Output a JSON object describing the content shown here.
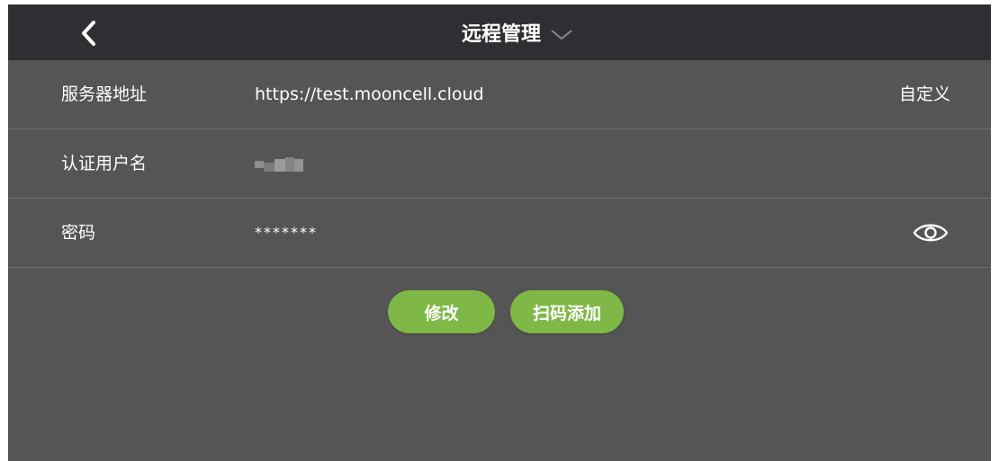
{
  "header": {
    "title": "远程管理"
  },
  "form": {
    "rows": [
      {
        "label": "服务器地址",
        "value": "https://test.mooncell.cloud",
        "action": "自定义"
      },
      {
        "label": "认证用户名",
        "value": ""
      },
      {
        "label": "密码",
        "value": "*******"
      }
    ]
  },
  "buttons": {
    "modify": "修改",
    "scan_add": "扫码添加"
  },
  "icons": {
    "back": "chevron-left-icon",
    "title_dropdown": "chevron-down-icon",
    "password_toggle": "eye-icon"
  },
  "colors": {
    "topbar": "#2f2f33",
    "background": "#555555",
    "accent": "#7fb846",
    "divider": "#6e6e6e"
  }
}
